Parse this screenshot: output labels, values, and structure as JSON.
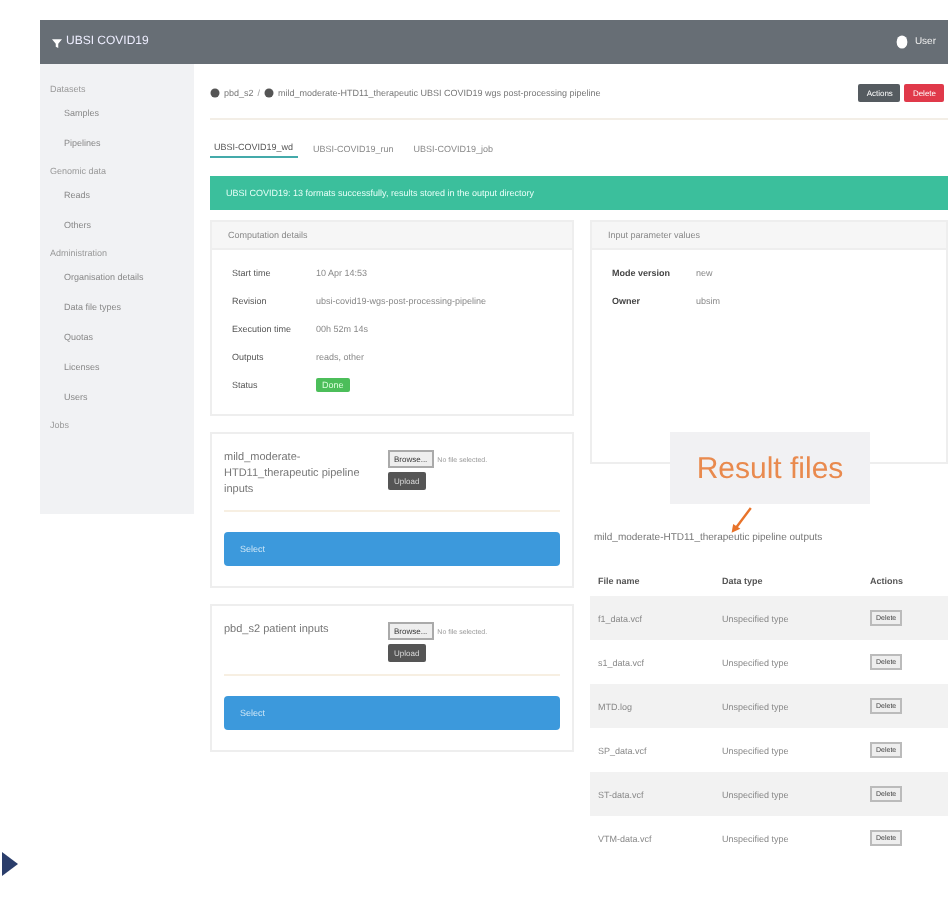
{
  "app": {
    "title": "UBSI COVID19",
    "user": "User"
  },
  "sidebar": {
    "sections": [
      {
        "heading": "Datasets",
        "items": [
          "Samples",
          "Pipelines"
        ]
      },
      {
        "heading": "Genomic data",
        "items": [
          "Reads",
          "Others"
        ]
      },
      {
        "heading": "Administration",
        "items": [
          "Organisation details",
          "Data file types",
          "Quotas",
          "Licenses",
          "Users"
        ]
      },
      {
        "heading": "Jobs"
      }
    ]
  },
  "breadcrumb_separator": "/",
  "breadcrumb": [
    "pbd_s2",
    "mild_moderate-HTD11_therapeutic UBSI COVID19 wgs post-processing pipeline"
  ],
  "header_buttons": [
    {
      "label": "Actions",
      "kind": "dark"
    },
    {
      "label": "Delete",
      "kind": "danger"
    }
  ],
  "tabs": [
    {
      "label": "UBSI-COVID19_wd",
      "selected": true
    },
    {
      "label": "UBSI-COVID19_run",
      "selected": false
    },
    {
      "label": "UBSI-COVID19_job",
      "selected": false
    }
  ],
  "alert": "UBSI COVID19: 13 formats successfully, results stored in the output directory",
  "computation": {
    "title": "Computation details",
    "rows": [
      {
        "label": "Start time",
        "value": "10 Apr 14:53",
        "kind": "text"
      },
      {
        "label": "Revision",
        "value": "ubsi-covid19-wgs-post-processing-pipeline",
        "kind": "text"
      },
      {
        "label": "Execution time",
        "value": "00h 52m 14s",
        "kind": "text"
      },
      {
        "label": "Outputs",
        "value": "reads, other",
        "kind": "text"
      },
      {
        "label": "Status",
        "value": "Done",
        "kind": "badge"
      }
    ]
  },
  "parameters": {
    "title": "Input parameter values",
    "rows": [
      {
        "label": "Mode version",
        "value": "new"
      },
      {
        "label": "Owner",
        "value": "ubsim"
      }
    ]
  },
  "inputs": [
    {
      "title": "mild_moderate-HTD11_therapeutic pipeline inputs",
      "browse": "Browse...",
      "file_status": "No file selected.",
      "upload": "Upload",
      "select": "Select"
    },
    {
      "title": "pbd_s2 patient inputs",
      "browse": "Browse...",
      "file_status": "No file selected.",
      "upload": "Upload",
      "select": "Select"
    }
  ],
  "outputs": {
    "title": "mild_moderate-HTD11_therapeutic pipeline outputs",
    "columns": [
      "File name",
      "Data type",
      "Actions"
    ],
    "rows": [
      {
        "name": "f1_data.vcf",
        "type": "Unspecified type",
        "action": "Delete"
      },
      {
        "name": "s1_data.vcf",
        "type": "Unspecified type",
        "action": "Delete"
      },
      {
        "name": "MTD.log",
        "type": "Unspecified type",
        "action": "Delete"
      },
      {
        "name": "SP_data.vcf",
        "type": "Unspecified type",
        "action": "Delete"
      },
      {
        "name": "ST-data.vcf",
        "type": "Unspecified type",
        "action": "Delete"
      },
      {
        "name": "VTM-data.vcf",
        "type": "Unspecified type",
        "action": "Delete"
      }
    ]
  },
  "callout": "Result files"
}
